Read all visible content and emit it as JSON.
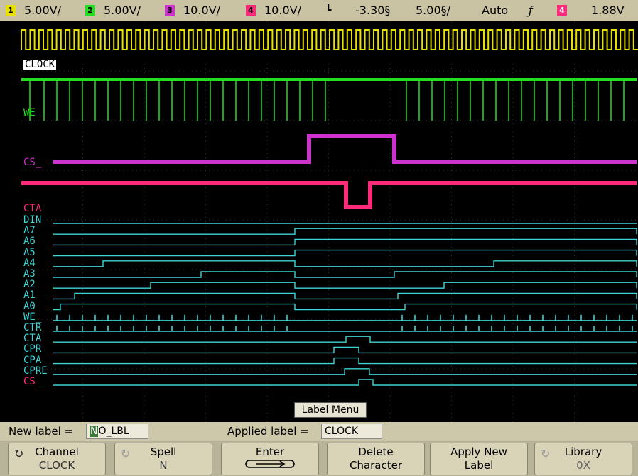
{
  "topbar": {
    "ch1_num": "1",
    "ch1_scale": "5.00V/",
    "ch2_num": "2",
    "ch2_scale": "5.00V/",
    "ch3_num": "3",
    "ch3_scale": "10.0V/",
    "ch4_num": "4",
    "ch4_scale": "10.0V/",
    "trigger_delay": "-3.30§",
    "timebase": "5.00§/",
    "trigger_mode": "Auto",
    "trigger_source_num": "4",
    "trigger_level": "1.88V",
    "colors": {
      "ch1": "#e8e000",
      "ch2": "#22dd22",
      "ch3": "#cc33cc",
      "ch4": "#ff2a7a"
    }
  },
  "channels": {
    "analog": [
      "CLOCK",
      "WE_",
      "CS_",
      "CTA"
    ],
    "digital": [
      "DIN",
      "A7",
      "A6",
      "A5",
      "A4",
      "A3",
      "A2",
      "A1",
      "A0",
      "WE_",
      "CTR",
      "CTA",
      "CPR",
      "CPA",
      "CPRE",
      "CS_"
    ],
    "digital_color": "#3fd3d3"
  },
  "label_menu": {
    "title": "Label Menu"
  },
  "label_row": {
    "new_label_text": "New label =",
    "new_label_cursor": "N",
    "new_label_value": "O_LBL",
    "applied_label_text": "Applied label =",
    "applied_label_value": "CLOCK"
  },
  "softkeys": [
    {
      "line1": "Channel",
      "line2": "CLOCK",
      "icon": "cycle-arrow-icon"
    },
    {
      "line1": "Spell",
      "line2": "N",
      "icon": "cycle-arrow-icon"
    },
    {
      "line1": "Enter",
      "line2": "",
      "icon": "enter-arrow-icon"
    },
    {
      "line1": "Delete",
      "line2": "Character",
      "icon": ""
    },
    {
      "line1": "Apply New",
      "line2": "Label",
      "icon": ""
    },
    {
      "line1": "Library",
      "line2": "0X",
      "icon": "cycle-arrow-icon"
    }
  ]
}
